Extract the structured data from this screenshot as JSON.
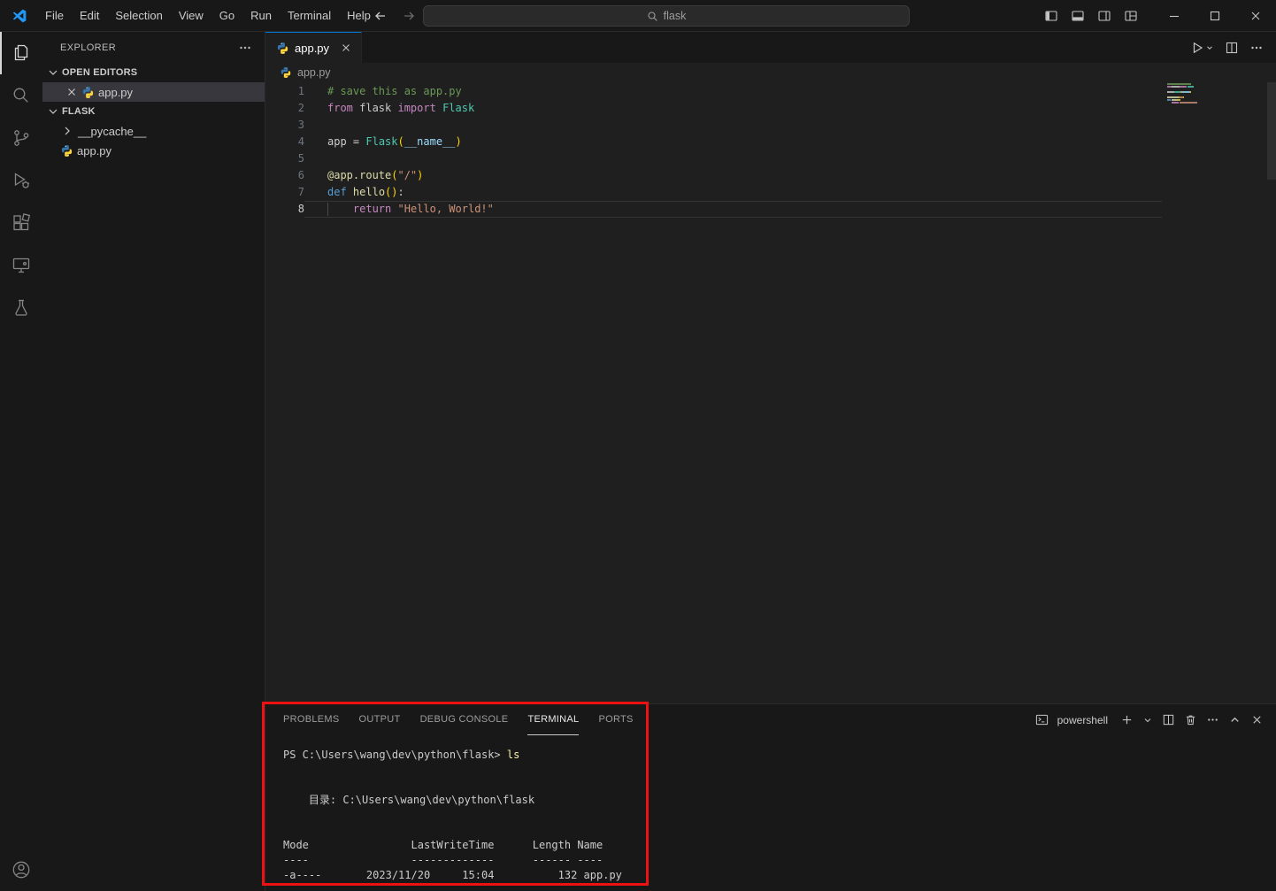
{
  "titlebar": {
    "menus": [
      "File",
      "Edit",
      "Selection",
      "View",
      "Go",
      "Run",
      "Terminal",
      "Help"
    ],
    "search": {
      "value": "flask"
    }
  },
  "activity_bar": {
    "items": [
      "explorer",
      "search",
      "source-control",
      "run-and-debug",
      "extensions",
      "remote-explorer",
      "testing"
    ],
    "active": "explorer",
    "bottom": [
      "account"
    ]
  },
  "sidebar": {
    "title": "EXPLORER",
    "sections": {
      "open_editors": {
        "label": "OPEN EDITORS",
        "items": [
          {
            "label": "app.py"
          }
        ]
      },
      "workspace": {
        "label": "FLASK",
        "items": [
          {
            "label": "__pycache__",
            "kind": "folder"
          },
          {
            "label": "app.py",
            "kind": "python-file"
          }
        ]
      }
    }
  },
  "editor": {
    "tabs": [
      {
        "label": "app.py",
        "active": true
      }
    ],
    "breadcrumb": [
      "app.py"
    ],
    "code_lines": [
      {
        "num": 1,
        "tokens": [
          {
            "t": "# save this as app.py",
            "c": "comment"
          }
        ]
      },
      {
        "num": 2,
        "tokens": [
          {
            "t": "from",
            "c": "keyword"
          },
          {
            "t": " flask ",
            "c": "plain"
          },
          {
            "t": "import",
            "c": "keyword"
          },
          {
            "t": " ",
            "c": "plain"
          },
          {
            "t": "Flask",
            "c": "class"
          }
        ]
      },
      {
        "num": 3,
        "tokens": []
      },
      {
        "num": 4,
        "tokens": [
          {
            "t": "app",
            "c": "plain"
          },
          {
            "t": " = ",
            "c": "plain"
          },
          {
            "t": "Flask",
            "c": "class"
          },
          {
            "t": "(",
            "c": "bracket"
          },
          {
            "t": "__name__",
            "c": "variable"
          },
          {
            "t": ")",
            "c": "bracket"
          }
        ]
      },
      {
        "num": 5,
        "tokens": []
      },
      {
        "num": 6,
        "tokens": [
          {
            "t": "@app.route",
            "c": "function"
          },
          {
            "t": "(",
            "c": "bracket"
          },
          {
            "t": "\"/\"",
            "c": "string"
          },
          {
            "t": ")",
            "c": "bracket"
          }
        ]
      },
      {
        "num": 7,
        "tokens": [
          {
            "t": "def",
            "c": "keyword2"
          },
          {
            "t": " ",
            "c": "plain"
          },
          {
            "t": "hello",
            "c": "function"
          },
          {
            "t": "(",
            "c": "bracket"
          },
          {
            "t": ")",
            "c": "bracket"
          },
          {
            "t": ":",
            "c": "plain"
          }
        ]
      },
      {
        "num": 8,
        "current": true,
        "tokens": [
          {
            "t": "",
            "c": "guide"
          },
          {
            "t": "    ",
            "c": "plain"
          },
          {
            "t": "return",
            "c": "keyword"
          },
          {
            "t": " ",
            "c": "plain"
          },
          {
            "t": "\"Hello, World!\"",
            "c": "string"
          }
        ]
      }
    ]
  },
  "panel": {
    "tabs": [
      {
        "label": "PROBLEMS",
        "active": false
      },
      {
        "label": "OUTPUT",
        "active": false
      },
      {
        "label": "DEBUG CONSOLE",
        "active": false
      },
      {
        "label": "TERMINAL",
        "active": true
      },
      {
        "label": "PORTS",
        "active": false
      }
    ],
    "shell_label": "powershell",
    "terminal_lines": [
      [
        {
          "t": "PS C:\\Users\\wang\\dev\\python\\flask> ",
          "c": "plain"
        },
        {
          "t": "ls",
          "c": "command"
        }
      ],
      [],
      [],
      [
        {
          "t": "    目录: C:\\Users\\wang\\dev\\python\\flask",
          "c": "plain"
        }
      ],
      [],
      [],
      [
        {
          "t": "Mode                LastWriteTime      Length Name",
          "c": "plain"
        }
      ],
      [
        {
          "t": "----                -------------      ------ ----",
          "c": "plain"
        }
      ],
      [
        {
          "t": "-a----       2023/11/20     15:04          132 app.py",
          "c": "plain"
        }
      ]
    ]
  },
  "colors": {
    "accent_blue": "#0078d4",
    "annotation_red": "#ee1111",
    "python_icon_blue": "#3776ab",
    "python_icon_yellow": "#ffd43b",
    "syntax": {
      "comment": "#6a9955",
      "keyword": "#c586c0",
      "keyword2": "#569cd6",
      "class": "#4ec9b0",
      "function": "#dcdcaa",
      "string": "#ce9178",
      "variable": "#9cdcfe",
      "bracket": "#ffd700",
      "plain": "#cccccc",
      "command": "#f9f1a5"
    }
  }
}
